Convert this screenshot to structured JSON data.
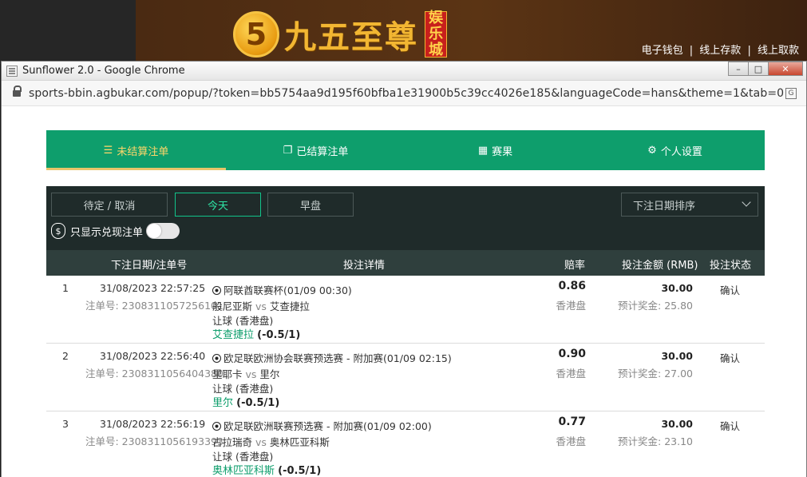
{
  "site": {
    "brand": "九五至尊",
    "tag_chars": [
      "娱",
      "乐",
      "城"
    ],
    "badge": "5",
    "links": [
      "电子钱包",
      "线上存款",
      "线上取款"
    ],
    "separator": "|"
  },
  "window": {
    "title": "Sunflower 2.0 - Google Chrome",
    "url": "sports-bbin.agbukar.com/popup/?token=bb5754aa9d195f60bfba1e31900b5c39cc4026e185&languageCode=hans&theme=1&tab=0",
    "controls": {
      "minimize": "–",
      "maximize": "□",
      "close": "✕"
    }
  },
  "tabs": [
    {
      "label": "未结算注单",
      "icon": "list-icon",
      "glyph": "☰",
      "active": true
    },
    {
      "label": "已结算注单",
      "icon": "settled-icon",
      "glyph": "❐",
      "active": false
    },
    {
      "label": "赛果",
      "icon": "results-icon",
      "glyph": "▦",
      "active": false
    },
    {
      "label": "个人设置",
      "icon": "gear-icon",
      "glyph": "⚙",
      "active": false
    }
  ],
  "filters": {
    "buttons": [
      "待定 / 取消",
      "今天",
      "早盘"
    ],
    "active_index": 1,
    "sort": "下注日期排序",
    "only_cashout_label": "只显示兑现注单",
    "money_glyph": "$"
  },
  "table": {
    "headers": [
      "下注日期/注单号",
      "投注详情",
      "赔率",
      "投注金额 (RMB)",
      "投注状态"
    ],
    "rows": [
      {
        "index": "1",
        "datetime": "31/08/2023 22:57:25",
        "bet_id": "注单号: 2308311057256101",
        "league": "阿联酋联赛杯(01/09 00:30)",
        "home": "般尼亚斯",
        "vs": "vs",
        "away": "艾查捷拉",
        "market": "让球 (香港盘)",
        "selection": "艾查捷拉",
        "handicap": "(-0.5/1)",
        "odds": "0.86",
        "odds_type": "香港盘",
        "stake": "30.00",
        "payout": "预计奖金: 25.80",
        "status": "确认"
      },
      {
        "index": "2",
        "datetime": "31/08/2023 22:56:40",
        "bet_id": "注单号: 2308311056404380",
        "league": "欧足联欧洲协会联赛预选赛 - 附加赛(01/09 02:15)",
        "home": "里耶卡",
        "vs": "vs",
        "away": "里尔",
        "market": "让球 (香港盘)",
        "selection": "里尔",
        "handicap": "(-0.5/1)",
        "odds": "0.90",
        "odds_type": "香港盘",
        "stake": "30.00",
        "payout": "预计奖金: 27.00",
        "status": "确认"
      },
      {
        "index": "3",
        "datetime": "31/08/2023 22:56:19",
        "bet_id": "注单号: 2308311056193393",
        "league": "欧足联欧洲联赛预选赛 - 附加赛(01/09 02:00)",
        "home": "古拉瑞奇",
        "vs": "vs",
        "away": "奥林匹亚科斯",
        "market": "让球 (香港盘)",
        "selection": "奥林匹亚科斯",
        "handicap": "(-0.5/1)",
        "odds": "0.77",
        "odds_type": "香港盘",
        "stake": "30.00",
        "payout": "预计奖金: 23.10",
        "status": "确认"
      }
    ]
  },
  "colors": {
    "tab_bg": "#0e9e6c",
    "tab_active_text": "#ffd76a",
    "panel_bg": "#1f2b2a",
    "header_bg": "#2f3f3d",
    "selection_text": "#0e9e6c"
  }
}
